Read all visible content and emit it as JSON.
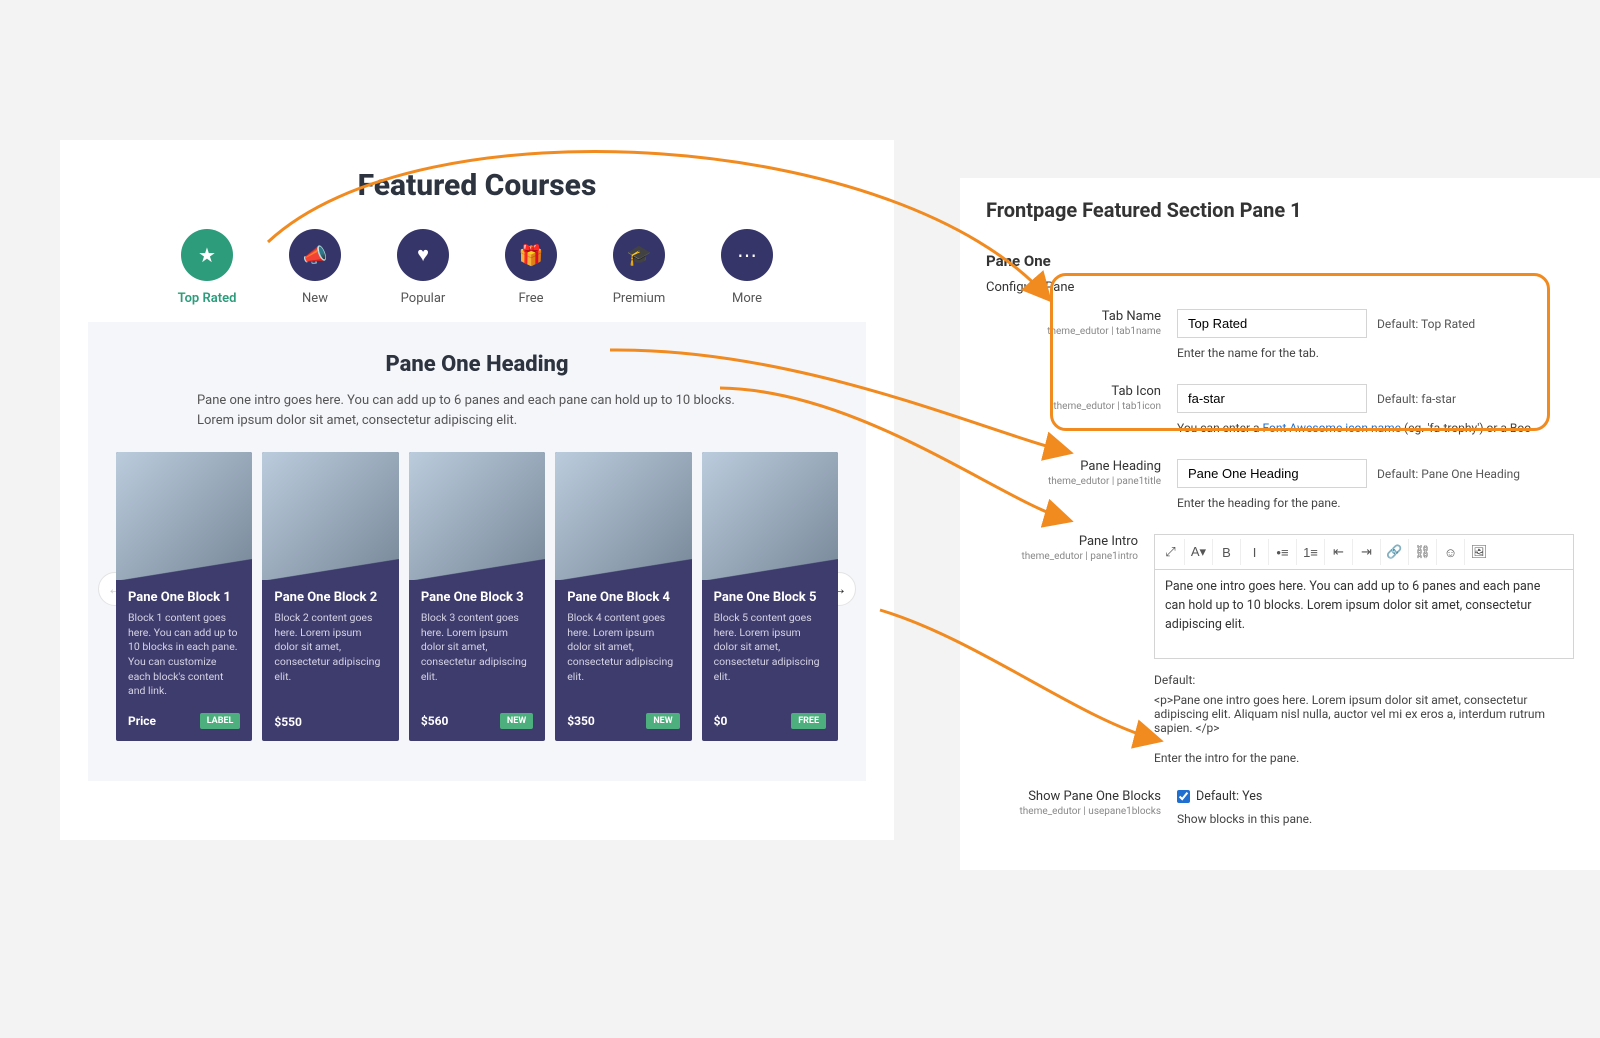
{
  "preview": {
    "title": "Featured Courses",
    "tabs": [
      {
        "label": "Top Rated",
        "icon": "star-icon",
        "glyph": "★",
        "active": true
      },
      {
        "label": "New",
        "icon": "bullhorn-icon",
        "glyph": "📣",
        "active": false
      },
      {
        "label": "Popular",
        "icon": "heart-icon",
        "glyph": "♥",
        "active": false
      },
      {
        "label": "Free",
        "icon": "gift-icon",
        "glyph": "🎁",
        "active": false
      },
      {
        "label": "Premium",
        "icon": "grad-cap-icon",
        "glyph": "🎓",
        "active": false
      },
      {
        "label": "More",
        "icon": "more-icon",
        "glyph": "⋯",
        "active": false
      }
    ],
    "pane_heading": "Pane One Heading",
    "pane_intro": "Pane one intro goes here. You can add up to 6 panes and each pane can hold up to 10 blocks. Lorem ipsum dolor sit amet, consectetur adipiscing elit.",
    "blocks": [
      {
        "title": "Pane One Block 1",
        "desc": "Block 1 content goes here. You can add up to 10 blocks in each pane. You can customize each block's content and link.",
        "price": "Price",
        "badge": "LABEL"
      },
      {
        "title": "Pane One Block 2",
        "desc": "Block 2 content goes here. Lorem ipsum dolor sit amet, consectetur adipiscing elit.",
        "price": "$550",
        "badge": ""
      },
      {
        "title": "Pane One Block 3",
        "desc": "Block 3 content goes here. Lorem ipsum dolor sit amet, consectetur adipiscing elit.",
        "price": "$560",
        "badge": "NEW"
      },
      {
        "title": "Pane One Block 4",
        "desc": "Block 4 content goes here. Lorem ipsum dolor sit amet, consectetur adipiscing elit.",
        "price": "$350",
        "badge": "NEW"
      },
      {
        "title": "Pane One Block 5",
        "desc": "Block 5 content goes here. Lorem ipsum dolor sit amet, consectetur adipiscing elit.",
        "price": "$0",
        "badge": "FREE"
      }
    ]
  },
  "settings": {
    "title": "Frontpage Featured Section Pane 1",
    "subtitle": "Pane One",
    "configure_label": "Configure Pane",
    "fields": {
      "tab_name": {
        "label": "Tab Name",
        "meta": "theme_edutor | tab1name",
        "value": "Top Rated",
        "default": "Default: Top Rated",
        "helper": "Enter the name for the tab."
      },
      "tab_icon": {
        "label": "Tab Icon",
        "meta": "theme_edutor | tab1icon",
        "value": "fa-star",
        "default": "Default: fa-star",
        "helper_pre": "You can enter a ",
        "helper_link": "Font Awesome icon name",
        "helper_post": " (eg. 'fa-trophy') or a Boo"
      },
      "pane_heading": {
        "label": "Pane Heading",
        "meta": "theme_edutor | pane1title",
        "value": "Pane One Heading",
        "default": "Default: Pane One Heading",
        "helper": "Enter the heading for the pane."
      },
      "pane_intro": {
        "label": "Pane Intro",
        "meta": "theme_edutor | pane1intro",
        "value": "Pane one intro goes here. You can add up to 6 panes and each pane can hold up to 10 blocks. Lorem ipsum dolor sit amet, consectetur adipiscing elit.",
        "default_label": "Default:",
        "default_html": "<p>Pane one intro goes here. Lorem ipsum dolor sit amet, consectetur adipiscing elit. Aliquam nisl nulla, auctor vel mi ex eros a, interdum rutrum sapien. </p>",
        "helper": "Enter the intro for the pane."
      },
      "show_blocks": {
        "label": "Show Pane One Blocks",
        "meta": "theme_edutor | usepane1blocks",
        "checked": true,
        "default": "Default: Yes",
        "helper": "Show blocks in this pane."
      }
    },
    "toolbar_icons": [
      "expand-icon",
      "font-family-icon",
      "bold-icon",
      "italic-icon",
      "ul-icon",
      "ol-icon",
      "indent-icon",
      "outdent-icon",
      "link-icon",
      "unlink-icon",
      "emoji-icon",
      "image-icon"
    ],
    "toolbar_glyphs": [
      "⤢",
      "A▾",
      "B",
      "I",
      "•≡",
      "1≡",
      "⇤",
      "⇥",
      "🔗",
      "⛓",
      "☺",
      "🖼"
    ]
  }
}
